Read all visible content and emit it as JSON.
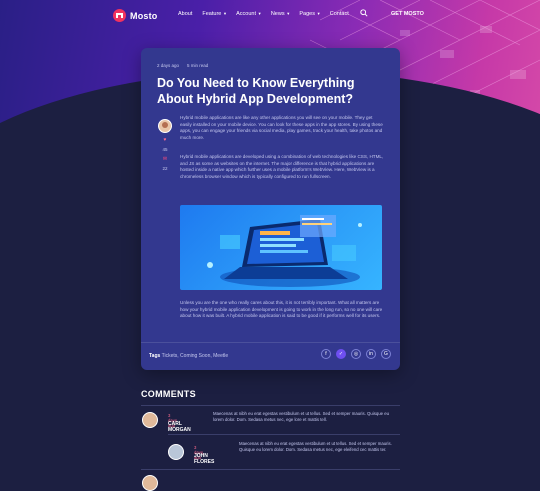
{
  "nav": {
    "brand": "Mosto",
    "items": [
      {
        "label": "About",
        "caret": ""
      },
      {
        "label": "Feature",
        "caret": "▾"
      },
      {
        "label": "Account",
        "caret": "▾"
      },
      {
        "label": "News",
        "caret": "▾"
      },
      {
        "label": "Pages",
        "caret": "▾"
      },
      {
        "label": "Contact",
        "caret": ""
      }
    ],
    "search_icon": "search-icon",
    "cta": "GET MOSTO"
  },
  "post": {
    "date": "2 days ago",
    "read_time": "5 min read",
    "title": "Do You Need to Know Everything About Hybrid App Development?",
    "likes": "45",
    "comments": "22",
    "paragraph1": "Hybrid mobile applications are like any other applications you will see on your mobile. They get easily installed on your mobile device. You can look for these apps in the app stores. By using these apps, you can engage your friends via social media, play games, track your health, take photos and much more.",
    "paragraph2": "Hybrid mobile applications are developed using a combination of web technologies like CSS, HTML, and JS as some as websites on the internet. The major difference is that hybrid applications are hosted inside a native app which further uses a mobile platform's WebView. Here, WebView is a chromeless browser window which is typically configured to run fullscreen.",
    "paragraph3": "Unless you are the one who really cares about this, it is not terribly important. What all matters are how your hybrid mobile application development is going to work in the long run, so no one will care about how it was built. A hybrid mobile application is said to be good if it performs well for its users.",
    "tags_label": "Tags",
    "tags": "Tickets, Coming Soon, Meetle"
  },
  "share_icons": [
    "facebook-icon",
    "twitter-icon",
    "instagram-icon",
    "linkedin-icon",
    "google-icon"
  ],
  "comments": {
    "title": "COMMENTS",
    "items": [
      {
        "date": "3 days ago",
        "name": "CARL MORGAN",
        "text": "Maecenas at nibh eu erat egestas vestibulum et ut tellus. Sed et semper mauris. Quisque eu lorem dolor. Dom. Sedasa metus nec, ege lore et mattis tell."
      },
      {
        "date": "3 days ago",
        "name": "JOHN FLORES",
        "text": "Maecenas at nibh eu erat egestas vestibulum et ut tellus. Sed et semper mauris. Quisque eu lorem dolor. Dom. Sedasa metus nec, ege eleifend cec mattis ter."
      }
    ]
  },
  "colors": {
    "accent": "#f0325f",
    "card": "#33388f",
    "background": "#1c1f41"
  }
}
